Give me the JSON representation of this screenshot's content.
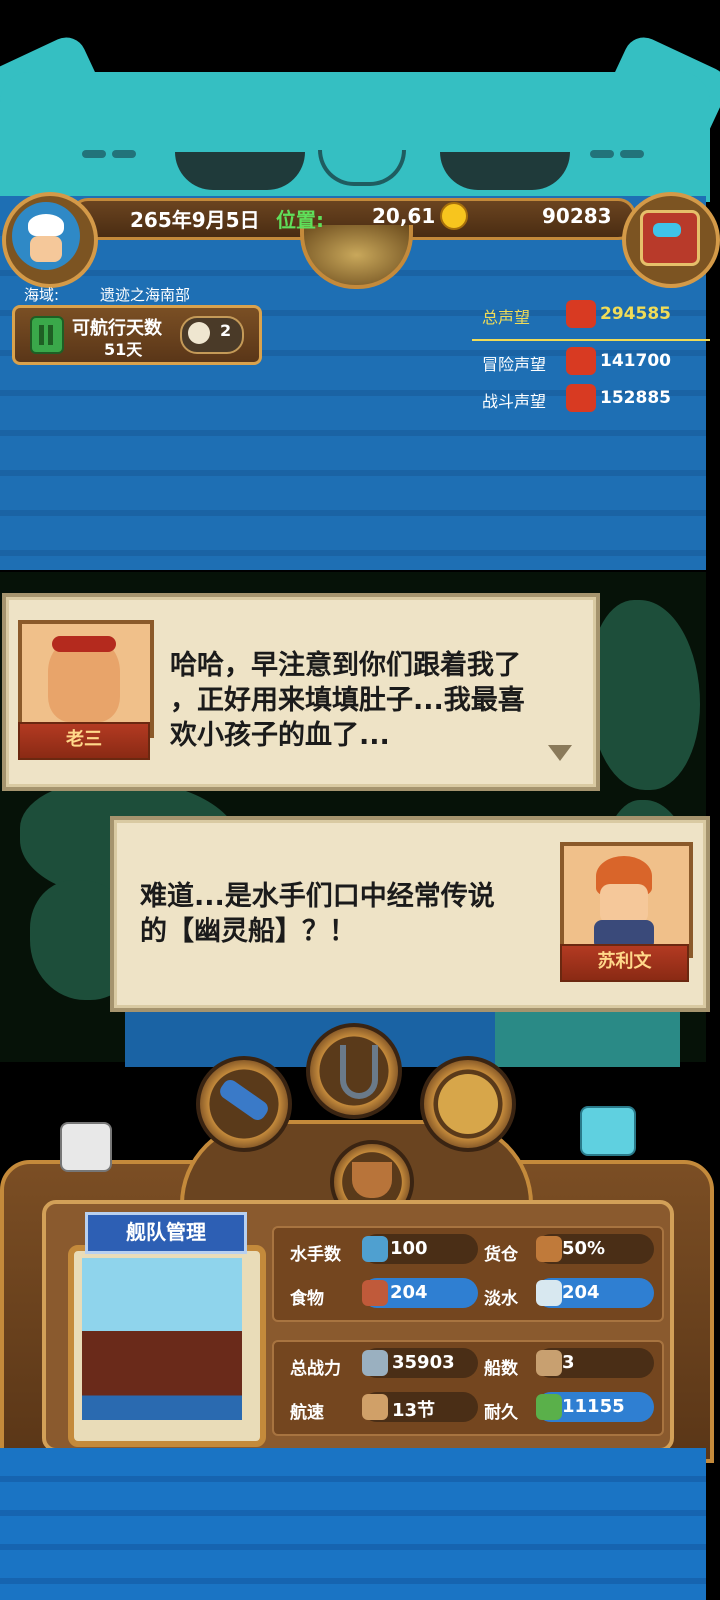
{
  "status_bar": {
    "date": "265年9月5日",
    "position_label": "位置:",
    "position_value": "20,61",
    "gold": "90283"
  },
  "sea_area": {
    "label": "海域:",
    "name": "遗迹之海南部"
  },
  "sailing": {
    "days_label": "可航行天数",
    "days_value": "51天",
    "speed": "2"
  },
  "reputation": {
    "total_label": "总声望",
    "total_value": "294585",
    "adventure_label": "冒险声望",
    "adventure_value": "141700",
    "combat_label": "战斗声望",
    "combat_value": "152885"
  },
  "dialog1": {
    "speaker": "老三",
    "line1": "哈哈，早注意到你们跟着我了",
    "line2": "，正好用来填填肚子...我最喜",
    "line3": "欢小孩子的血了..."
  },
  "dialog2": {
    "speaker": "苏利文",
    "line1": "难道...是水手们口中经常传说",
    "line2": "的【幽灵船】？！"
  },
  "fleet": {
    "title": "舰队管理",
    "sailors_label": "水手数",
    "sailors_value": "100",
    "cargo_label": "货仓",
    "cargo_value": "50%",
    "food_label": "食物",
    "food_value": "204",
    "water_label": "淡水",
    "water_value": "204",
    "power_label": "总战力",
    "power_value": "35903",
    "ships_label": "船数",
    "ships_value": "3",
    "speed_label": "航速",
    "speed_value": "13节",
    "durability_label": "耐久",
    "durability_value": "11155"
  },
  "colors": {
    "accent_gold": "#c48a3b",
    "total_rep": "#f0dc58",
    "position_green": "#5fe05a"
  }
}
